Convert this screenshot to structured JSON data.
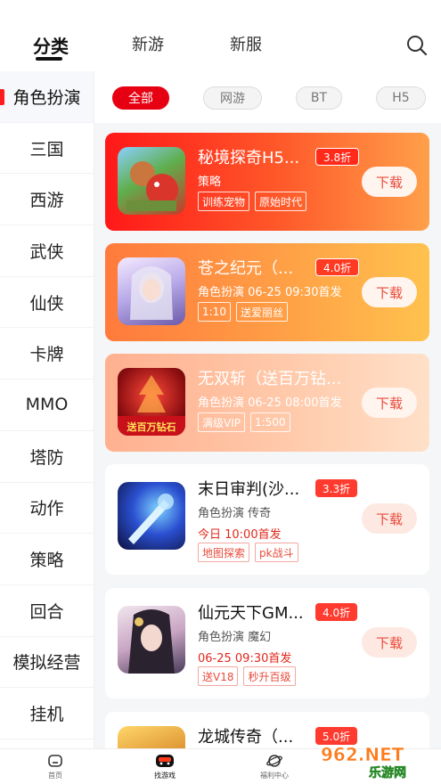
{
  "header": {
    "tabs": [
      {
        "label": "分类"
      },
      {
        "label": "新游"
      },
      {
        "label": "新服"
      }
    ]
  },
  "sidebar": {
    "items": [
      {
        "label": "角色扮演"
      },
      {
        "label": "三国"
      },
      {
        "label": "西游"
      },
      {
        "label": "武侠"
      },
      {
        "label": "仙侠"
      },
      {
        "label": "卡牌"
      },
      {
        "label": "MMO"
      },
      {
        "label": "塔防"
      },
      {
        "label": "动作"
      },
      {
        "label": "策略"
      },
      {
        "label": "回合"
      },
      {
        "label": "模拟经营"
      },
      {
        "label": "挂机"
      }
    ]
  },
  "filters": [
    {
      "label": "全部"
    },
    {
      "label": "网游"
    },
    {
      "label": "BT"
    },
    {
      "label": "H5"
    }
  ],
  "games": [
    {
      "name": "秘境探奇H5...",
      "discount": "3.8折",
      "category": "策略",
      "tags": [
        "训练宠物",
        "原始时代"
      ],
      "download": "下载"
    },
    {
      "name": "苍之纪元（...",
      "discount": "4.0折",
      "category": "角色扮演  06-25 09:30首发",
      "tags": [
        "1:10",
        "送爱丽丝"
      ],
      "download": "下载"
    },
    {
      "name": "无双斩（送百万钻...",
      "category": "角色扮演  06-25 08:00首发",
      "tags": [
        "满级VIP",
        "1:500"
      ],
      "download": "下载",
      "icon_text": "送百万钻石"
    },
    {
      "name": "末日审判(沙...",
      "discount": "3.3折",
      "category": "角色扮演  传奇",
      "release": "今日 10:00首发",
      "tags": [
        "地图探索",
        "pk战斗"
      ],
      "download": "下载"
    },
    {
      "name": "仙元天下GM...",
      "discount": "4.0折",
      "category": "角色扮演  魔幻",
      "release": "06-25 09:30首发",
      "tags": [
        "送V18",
        "秒升百级"
      ],
      "download": "下载"
    },
    {
      "name": "龙城传奇（...",
      "discount": "5.0折"
    }
  ],
  "bottom_nav": [
    {
      "label": "首页",
      "icon": "home-icon"
    },
    {
      "label": "找游戏",
      "icon": "gamepad-icon"
    },
    {
      "label": "福利中心",
      "icon": "planet-icon"
    }
  ],
  "watermark": {
    "text": "962.NET",
    "subtext": "乐游网"
  },
  "colors": {
    "accent": "#e60012",
    "active_mark": "#ff1e1e"
  }
}
